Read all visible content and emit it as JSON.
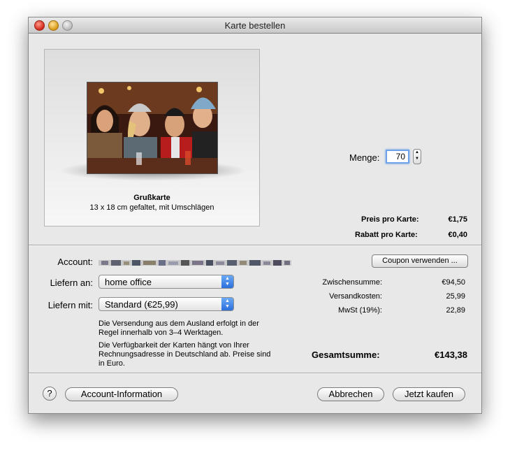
{
  "window": {
    "title": "Karte bestellen"
  },
  "preview": {
    "card_name": "Grußkarte",
    "card_description": "13 x 18 cm gefaltet, mit Umschlägen"
  },
  "quantity": {
    "label": "Menge:",
    "value": "70"
  },
  "pricing": {
    "price_per_card_label": "Preis pro Karte:",
    "price_per_card_value": "€1,75",
    "discount_per_card_label": "Rabatt pro Karte:",
    "discount_per_card_value": "€0,40"
  },
  "account": {
    "label": "Account:"
  },
  "coupon_button": "Coupon verwenden ...",
  "shipping": {
    "ship_to_label": "Liefern an:",
    "ship_to_value": "home office",
    "ship_with_label": "Liefern mit:",
    "ship_with_value": "Standard (€25,99)",
    "note_1": "Die Versendung aus dem Ausland erfolgt in der Regel innerhalb von 3–4 Werktagen.",
    "note_2": "Die Verfügbarkeit der Karten hängt von Ihrer Rechnungsadresse in Deutschland ab. Preise sind in Euro."
  },
  "summary": {
    "subtotal_label": "Zwischensumme:",
    "subtotal_value": "€94,50",
    "shipping_label": "Versandkosten:",
    "shipping_value": "25,99",
    "vat_label": "MwSt (19%):",
    "vat_value": "22,89",
    "total_label": "Gesamtsumme:",
    "total_value": "€143,38"
  },
  "footer": {
    "help": "?",
    "account_info": "Account-Information",
    "cancel": "Abbrechen",
    "buy": "Jetzt kaufen"
  },
  "colors": {
    "focus": "#6ea2e6",
    "popup_accent": "#2a6fdc"
  },
  "icons": {
    "help": "question-mark-icon",
    "stepper": "stepper-arrows-icon",
    "popup": "popup-arrows-icon"
  }
}
